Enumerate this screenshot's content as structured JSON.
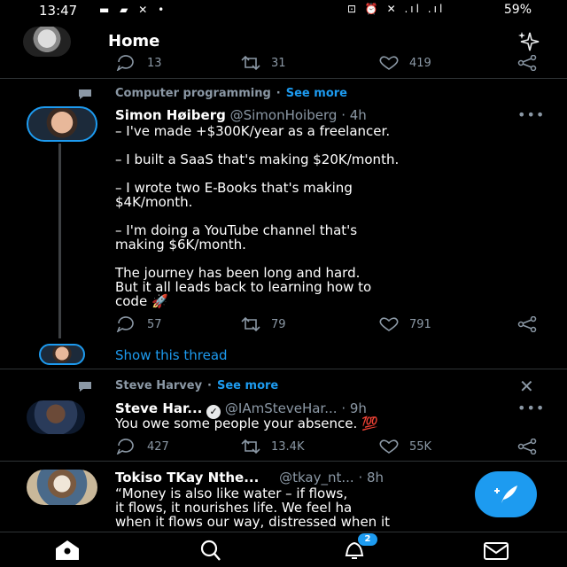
{
  "status_bar": {
    "time": "13:47",
    "battery": "59%"
  },
  "header": {
    "title": "Home"
  },
  "tweet0_actions": {
    "replies": "13",
    "retweets": "31",
    "likes": "419"
  },
  "tweet1": {
    "context": "Computer programming",
    "see_more": "See more",
    "name": "Simon Høiberg",
    "handle": "@SimonHoiberg",
    "time": "· 4h",
    "lines": [
      "– I've made +$300K/year as a freelancer.",
      "– I built a SaaS that's making $20K/month.",
      "– I wrote two E-Books that's making",
      "$4K/month.",
      "– I'm doing a YouTube channel that's",
      "making $6K/month.",
      "The journey has been long and hard.",
      "But it all leads back to learning how to",
      "code 🚀"
    ],
    "replies": "57",
    "retweets": "79",
    "likes": "791",
    "show_thread": "Show this thread"
  },
  "tweet2": {
    "context": "Steve Harvey",
    "see_more": "See more",
    "name": "Steve Har...",
    "handle": "@IAmSteveHar...",
    "time": "· 9h",
    "text": "You owe some people your absence. 💯",
    "replies": "427",
    "retweets": "13.4K",
    "likes": "55K"
  },
  "tweet3": {
    "name": "Tokiso TKay Nthe...",
    "handle": "@tkay_nt...",
    "time": "· 8h",
    "lines": [
      "“Money is also like water – if flows,",
      "it flows, it nourishes life. We feel ha",
      "when it flows our way, distressed when it"
    ]
  },
  "bottom_nav": {
    "notifications_badge": "2"
  },
  "colors": {
    "accent": "#1d9bf0",
    "muted": "#8b98a5",
    "background": "#000000"
  },
  "icons": [
    "home-icon",
    "search-icon",
    "bell-icon",
    "mail-icon",
    "sparkle-icon",
    "compose-icon"
  ]
}
